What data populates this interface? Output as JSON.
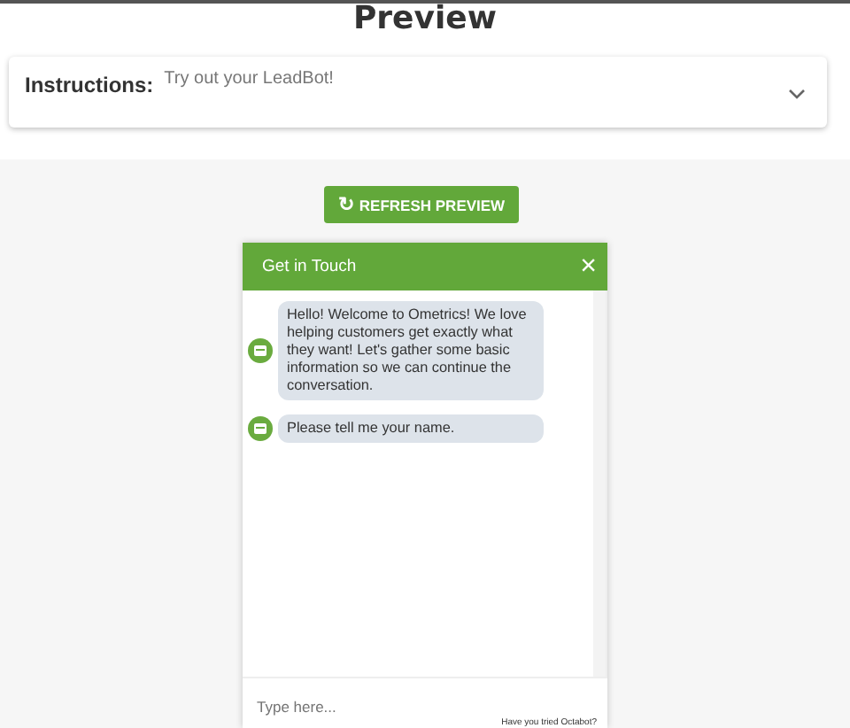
{
  "title": "Preview",
  "instructions": {
    "label": "Instructions:",
    "text": "Try out your LeadBot!",
    "expanded": false
  },
  "refresh_button": {
    "icon": "↻",
    "label": "REFRESH PREVIEW"
  },
  "chat": {
    "title": "Get in Touch",
    "close": "×",
    "messages": [
      {
        "text": "Hello! Welcome to Ometrics! We love helping customers get exactly what they want! Let's gather some basic information so we can continue the conversation."
      },
      {
        "text": "Please tell me your name."
      }
    ],
    "input": {
      "placeholder": "Type here..."
    },
    "footer": "Have you tried Octabot?"
  }
}
